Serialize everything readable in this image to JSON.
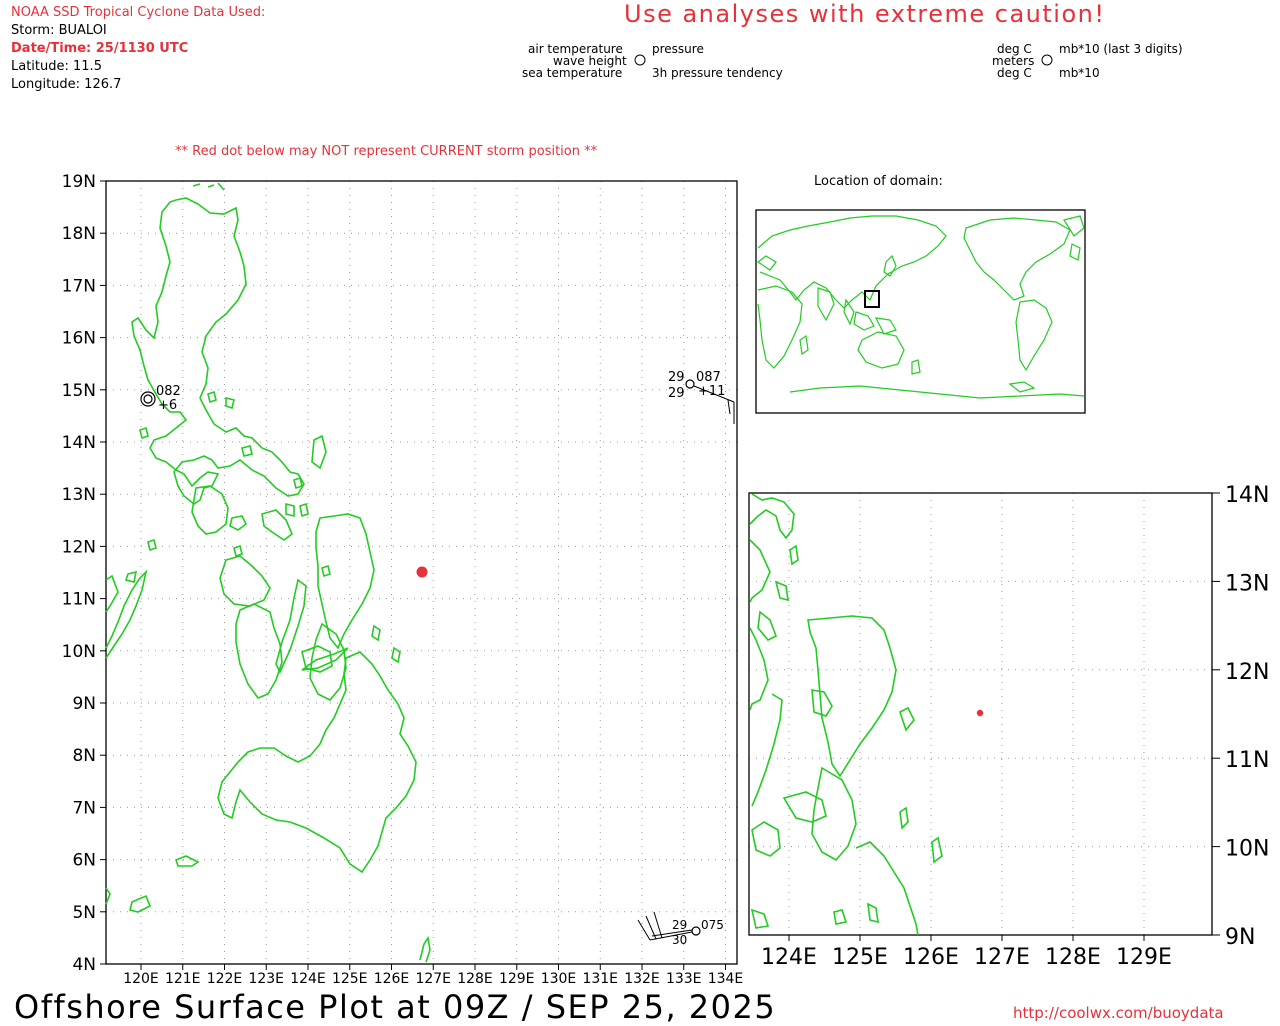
{
  "header": {
    "source": "NOAA SSD Tropical Cyclone Data Used:",
    "storm": "Storm: BUALOI",
    "datetime": "Date/Time: 25/1130 UTC",
    "latitude": "Latitude: 11.5",
    "longitude": "Longitude: 126.7"
  },
  "caution": "Use analyses with extreme caution!",
  "legend_left": {
    "air_temperature": "air temperature",
    "wave_height": "wave height",
    "sea_temperature": "sea temperature",
    "pressure": "pressure",
    "pressure_tendency": "3h pressure tendency"
  },
  "legend_right": {
    "deg_c_top": "deg C",
    "meters": "meters",
    "deg_c_bottom": "deg C",
    "pressure_unit": "mb*10 (last 3 digits)",
    "tendency_unit": "mb*10"
  },
  "red_dot_note": "** Red dot below may NOT represent CURRENT storm position **",
  "location_label": "Location of domain:",
  "main_map": {
    "lat_labels": [
      "19N",
      "18N",
      "17N",
      "16N",
      "15N",
      "14N",
      "13N",
      "12N",
      "11N",
      "10N",
      "9N",
      "8N",
      "7N",
      "6N",
      "5N",
      "4N"
    ],
    "lon_labels": [
      "120E",
      "121E",
      "122E",
      "123E",
      "124E",
      "125E",
      "126E",
      "127E",
      "128E",
      "129E",
      "130E",
      "131E",
      "132E",
      "133E",
      "134E"
    ],
    "storm": {
      "lat": 11.5,
      "lon": 126.7,
      "color": "#e8303a"
    }
  },
  "zoom_map": {
    "lat_labels": [
      "14N",
      "13N",
      "12N",
      "11N",
      "10N",
      "9N"
    ],
    "lon_labels": [
      "124E",
      "125E",
      "126E",
      "127E",
      "128E",
      "129E"
    ]
  },
  "stations": [
    {
      "id": "station-west",
      "pressure": "082",
      "tendency": "+6"
    },
    {
      "id": "station-northeast",
      "air_temp": "29",
      "pressure": "087",
      "sea_temp": "29",
      "tendency": "+11"
    },
    {
      "id": "station-southeast",
      "air_temp": "29",
      "pressure": "075",
      "sea_temp": "30"
    }
  ],
  "title": "Offshore Surface Plot at 09Z / SEP 25, 2025",
  "url": "http://coolwx.com/buoydata",
  "colors": {
    "land": "#22cc22",
    "accent": "#e8303a",
    "grid": "#9a9a9a"
  }
}
